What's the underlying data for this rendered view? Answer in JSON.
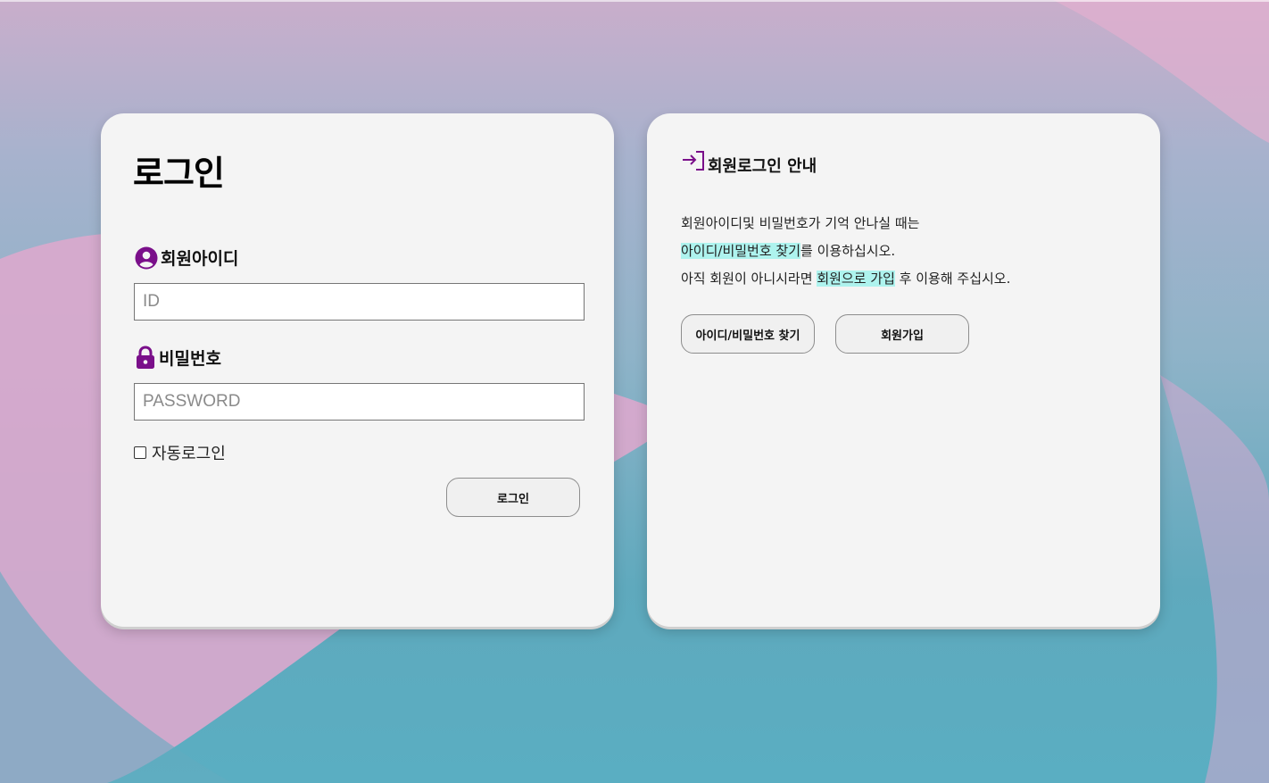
{
  "login": {
    "title": "로그인",
    "id_label": "회원아이디",
    "id_placeholder": "ID",
    "pw_label": "비밀번호",
    "pw_placeholder": "PASSWORD",
    "auto_login_label": "자동로그인",
    "auto_login_checked": false,
    "login_button": "로그인"
  },
  "info": {
    "title": "회원로그인 안내",
    "line1": "회원아이디및 비밀번호가 기억 안나실 때는",
    "line2_link": "아이디/비밀번호 찾기",
    "line2_rest": "를 이용하십시오.",
    "line3_pre": "아직 회원이 아니시라면 ",
    "line3_link": "회원으로 가입",
    "line3_rest": " 후 이용해 주십시오.",
    "find_button": "아이디/비밀번호 찾기",
    "join_button": "회원가입"
  },
  "icons": {
    "user": "user-circle-icon",
    "lock": "lock-icon",
    "login": "login-arrow-icon"
  },
  "colors": {
    "accent": "#7a0f8a",
    "highlight": "#aef3ee",
    "card": "#f4f4f4"
  }
}
